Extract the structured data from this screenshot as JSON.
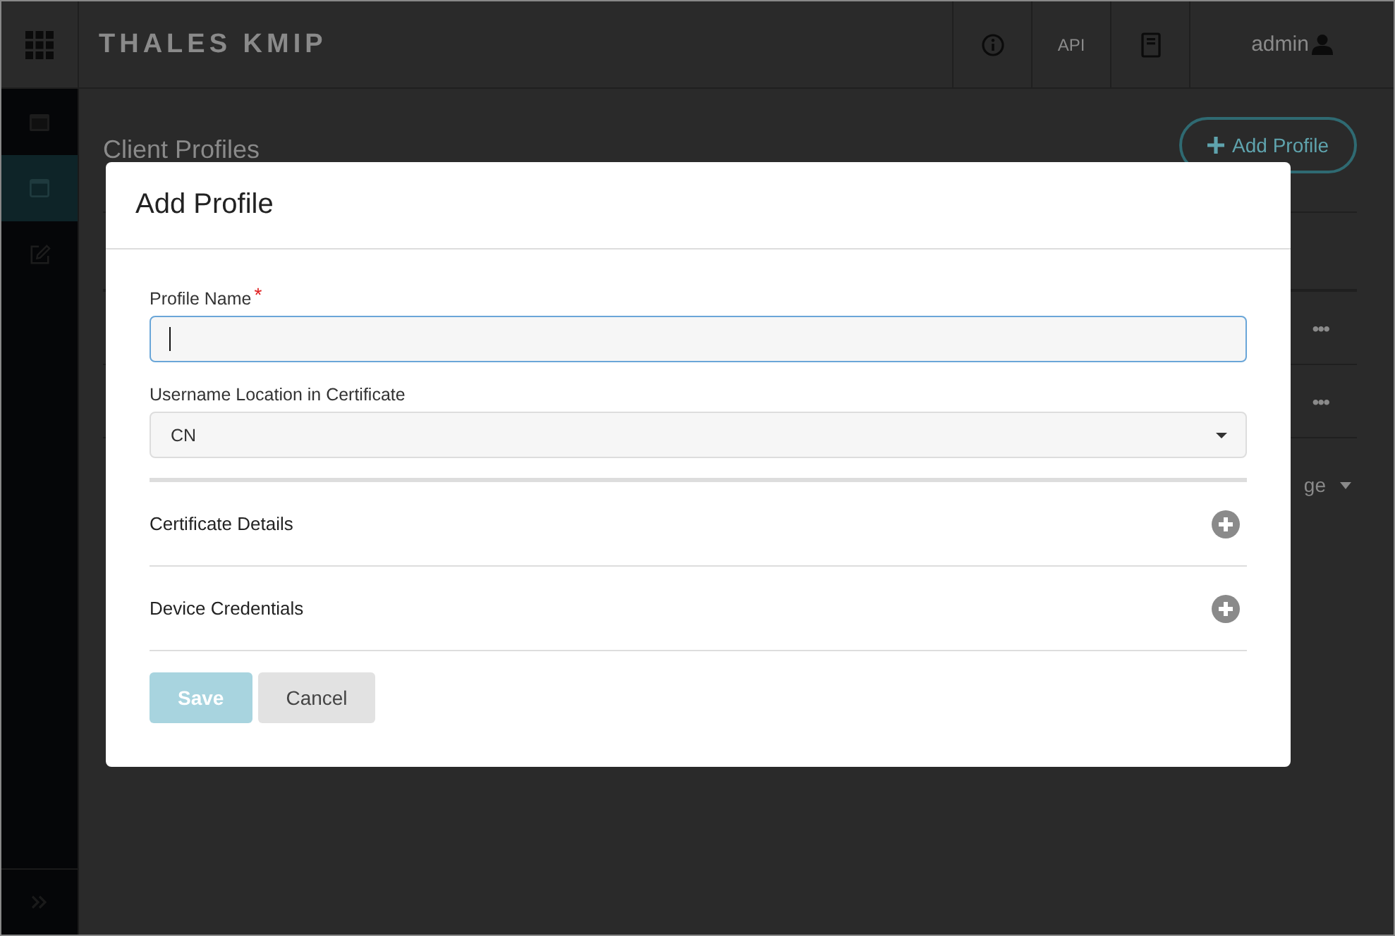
{
  "topbar": {
    "logo": "THALES KMIP",
    "api_label": "API",
    "user": "admin"
  },
  "sidebar": {
    "items": [
      {
        "kind": "panel",
        "selected": false
      },
      {
        "kind": "calendar",
        "selected": true
      },
      {
        "kind": "edit",
        "selected": false
      }
    ]
  },
  "page": {
    "title": "Client Profiles",
    "add_button": "Add Profile",
    "rows": [
      {
        "menu": "•••"
      },
      {
        "menu": "•••"
      }
    ],
    "pagination_fragment": "ge"
  },
  "modal": {
    "title": "Add Profile",
    "fields": [
      {
        "kind": "text",
        "label": "Profile Name",
        "required_mark": "*",
        "focused": true
      },
      {
        "kind": "select",
        "label": "Username Location in Certificate",
        "focused": false,
        "value": "CN"
      }
    ],
    "sections": [
      {
        "label": "Certificate Details",
        "expanded": false
      },
      {
        "label": "Device Credentials",
        "expanded": false
      }
    ],
    "buttons": [
      {
        "label": "Save",
        "kind": "primary",
        "disabled": true
      },
      {
        "label": "Cancel",
        "kind": "secondary",
        "disabled": false
      }
    ]
  }
}
